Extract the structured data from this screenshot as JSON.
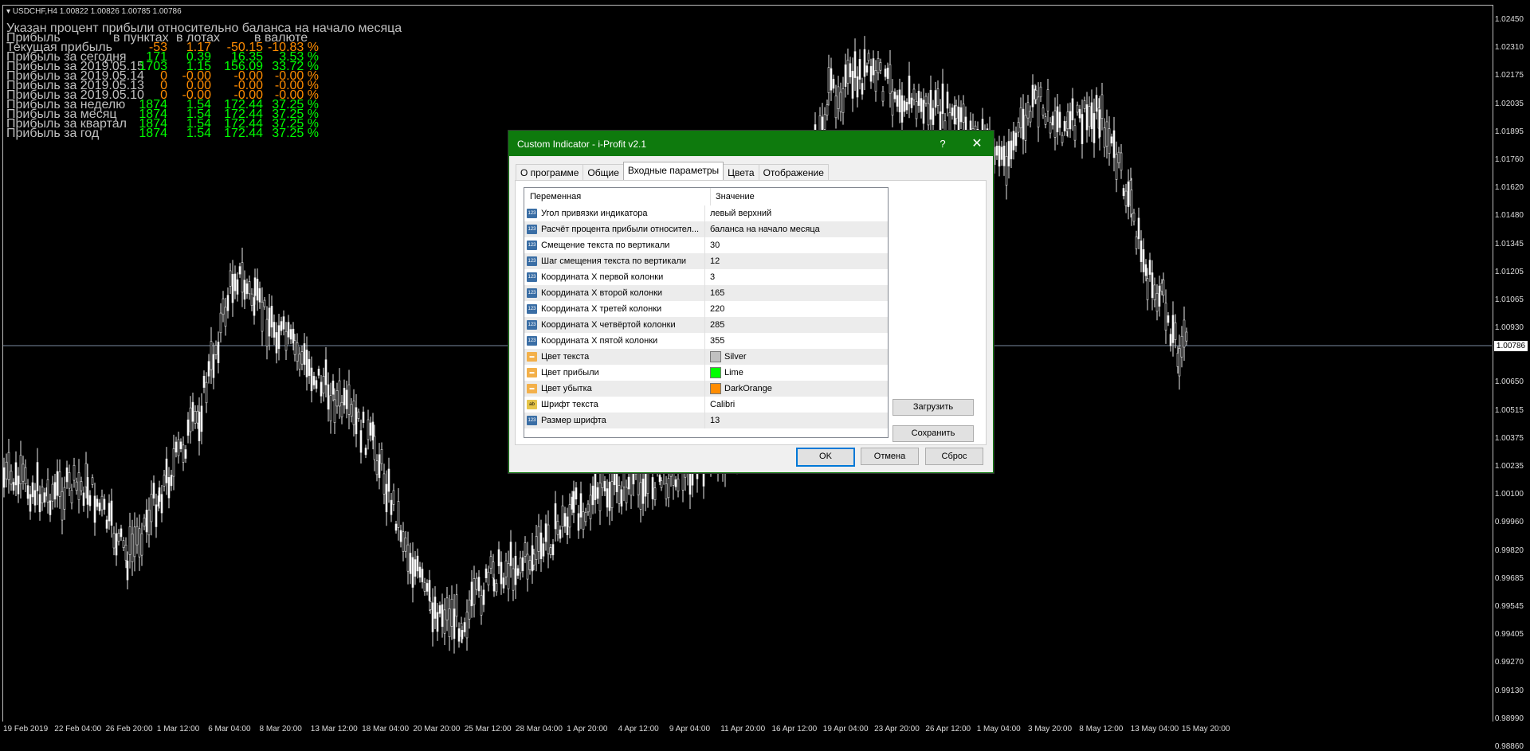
{
  "chart": {
    "symbol_title": "USDCHF,H4  1.00822 1.00826 1.00785 1.00786",
    "current_price": "1.00786",
    "price_axis": [
      "1.02450",
      "1.02310",
      "1.02175",
      "1.02035",
      "1.01895",
      "1.01760",
      "1.01620",
      "1.01480",
      "1.01345",
      "1.01205",
      "1.01065",
      "1.00930",
      "1.00650",
      "1.00515",
      "1.00375",
      "1.00235",
      "1.00100",
      "0.99960",
      "0.99820",
      "0.99685",
      "0.99545",
      "0.99405",
      "0.99270",
      "0.99130",
      "0.98990",
      "0.98860"
    ],
    "time_axis": [
      "19 Feb 2019",
      "22 Feb 04:00",
      "26 Feb 20:00",
      "1 Mar 12:00",
      "6 Mar 04:00",
      "8 Mar 20:00",
      "13 Mar 12:00",
      "18 Mar 04:00",
      "20 Mar 20:00",
      "25 Mar 12:00",
      "28 Mar 04:00",
      "1 Apr 20:00",
      "4 Apr 12:00",
      "9 Apr 04:00",
      "11 Apr 20:00",
      "16 Apr 12:00",
      "19 Apr 04:00",
      "23 Apr 20:00",
      "26 Apr 12:00",
      "1 May 04:00",
      "3 May 20:00",
      "8 May 12:00",
      "13 May 04:00",
      "15 May 20:00"
    ]
  },
  "overlay": {
    "header": "Указан процент прибыли относительно баланса на начало месяца",
    "col_header_profit": "Прибыль",
    "col_header_points": "в пунктах",
    "col_header_lots": "в лотах",
    "col_header_currency": "в валюте",
    "rows": [
      {
        "label": "Текущая прибыль",
        "points": "-53",
        "lots": "1.17",
        "money": "-50.15",
        "pct": "-10.83 %",
        "color": "orange"
      },
      {
        "label": "Прибыль за сегодня",
        "points": "171",
        "lots": "0.39",
        "money": "16.35",
        "pct": "3.53 %",
        "color": "lime"
      },
      {
        "label": "Прибыль за 2019.05.15",
        "points": "1703",
        "lots": "1.15",
        "money": "156.09",
        "pct": "33.72 %",
        "color": "lime"
      },
      {
        "label": "Прибыль за 2019.05.14",
        "points": "0",
        "lots": "-0.00",
        "money": "-0.00",
        "pct": "-0.00 %",
        "color": "orange"
      },
      {
        "label": "Прибыль за 2019.05.13",
        "points": "0",
        "lots": "0.00",
        "money": "-0.00",
        "pct": "-0.00 %",
        "color": "orange"
      },
      {
        "label": "Прибыль за 2019.05.10",
        "points": "0",
        "lots": "-0.00",
        "money": "-0.00",
        "pct": "-0.00 %",
        "color": "orange"
      },
      {
        "label": "Прибыль за неделю",
        "points": "1874",
        "lots": "1.54",
        "money": "172.44",
        "pct": "37.25 %",
        "color": "lime"
      },
      {
        "label": "Прибыль за месяц",
        "points": "1874",
        "lots": "1.54",
        "money": "172.44",
        "pct": "37.25 %",
        "color": "lime"
      },
      {
        "label": "Прибыль за квартал",
        "points": "1874",
        "lots": "1.54",
        "money": "172.44",
        "pct": "37.25 %",
        "color": "lime"
      },
      {
        "label": "Прибыль за год",
        "points": "1874",
        "lots": "1.54",
        "money": "172.44",
        "pct": "37.25 %",
        "color": "lime"
      }
    ]
  },
  "dialog": {
    "title": "Custom Indicator - i-Profit v2.1",
    "help": "?",
    "close": "✕",
    "tabs": [
      "О программе",
      "Общие",
      "Входные параметры",
      "Цвета",
      "Отображение"
    ],
    "active_tab": "Входные параметры",
    "grid_header_var": "Переменная",
    "grid_header_val": "Значение",
    "params": [
      {
        "name": "Угол привязки индикатора",
        "value": "левый верхний",
        "type": "num"
      },
      {
        "name": "Расчёт процента прибыли относител...",
        "value": "баланса на начало месяца",
        "type": "num"
      },
      {
        "name": "Смещение текста по вертикали",
        "value": "30",
        "type": "num"
      },
      {
        "name": "Шаг смещения текста по вертикали",
        "value": "12",
        "type": "num"
      },
      {
        "name": "Координата X первой колонки",
        "value": "3",
        "type": "num"
      },
      {
        "name": "Координата X второй колонки",
        "value": "165",
        "type": "num"
      },
      {
        "name": "Координата X третей колонки",
        "value": "220",
        "type": "num"
      },
      {
        "name": "Координата X четвёртой колонки",
        "value": "285",
        "type": "num"
      },
      {
        "name": "Координата X пятой колонки",
        "value": "355",
        "type": "num"
      },
      {
        "name": "Цвет текста",
        "value": "Silver",
        "type": "color",
        "swatch": "#c0c0c0"
      },
      {
        "name": "Цвет прибыли",
        "value": "Lime",
        "type": "color",
        "swatch": "#00ff00"
      },
      {
        "name": "Цвет убытка",
        "value": "DarkOrange",
        "type": "color",
        "swatch": "#ff8c00"
      },
      {
        "name": "Шрифт текста",
        "value": "Calibri",
        "type": "str"
      },
      {
        "name": "Размер шрифта",
        "value": "13",
        "type": "num"
      }
    ],
    "load_label": "Загрузить",
    "save_label": "Сохранить",
    "ok_label": "OK",
    "cancel_label": "Отмена",
    "reset_label": "Сброс"
  },
  "colors": {
    "silver": "#c0c0c0",
    "lime": "#00ff00",
    "orange": "#ff8c00",
    "dialog_title": "#0e7a0d"
  }
}
